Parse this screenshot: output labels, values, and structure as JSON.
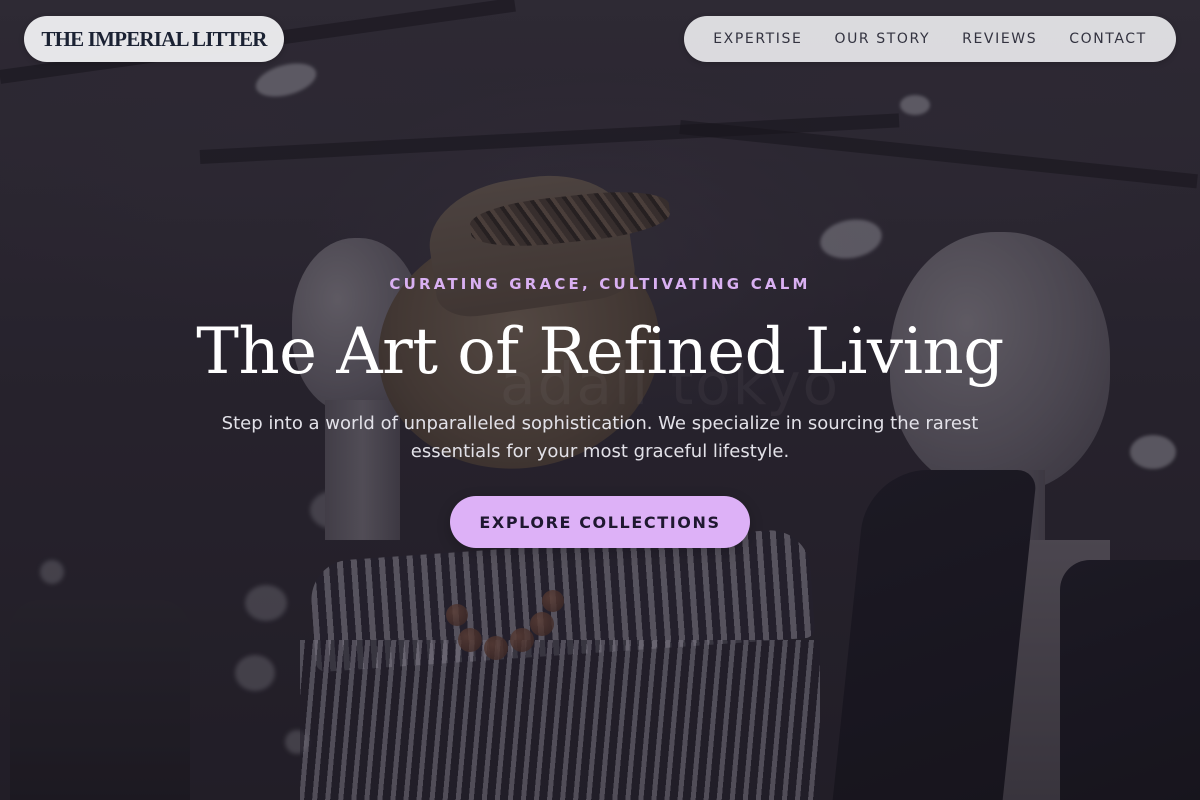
{
  "header": {
    "logo_text": "THE IMPERIAL LITTER",
    "nav": [
      {
        "label": "EXPERTISE"
      },
      {
        "label": "OUR STORY"
      },
      {
        "label": "REVIEWS"
      },
      {
        "label": "CONTACT"
      }
    ]
  },
  "hero": {
    "eyebrow": "CURATING GRACE, CULTIVATING CALM",
    "title": "The Art of Refined Living",
    "description": "Step into a world of unparalleled sophistication. We specialize in sourcing the rarest essentials for your most graceful lifestyle.",
    "cta_label": "EXPLORE COLLECTIONS"
  },
  "colors": {
    "accent": "#ddb1f7",
    "eyebrow": "#d9b0f2",
    "logo_text": "#1b2233",
    "pill_background": "#eeeef0"
  }
}
